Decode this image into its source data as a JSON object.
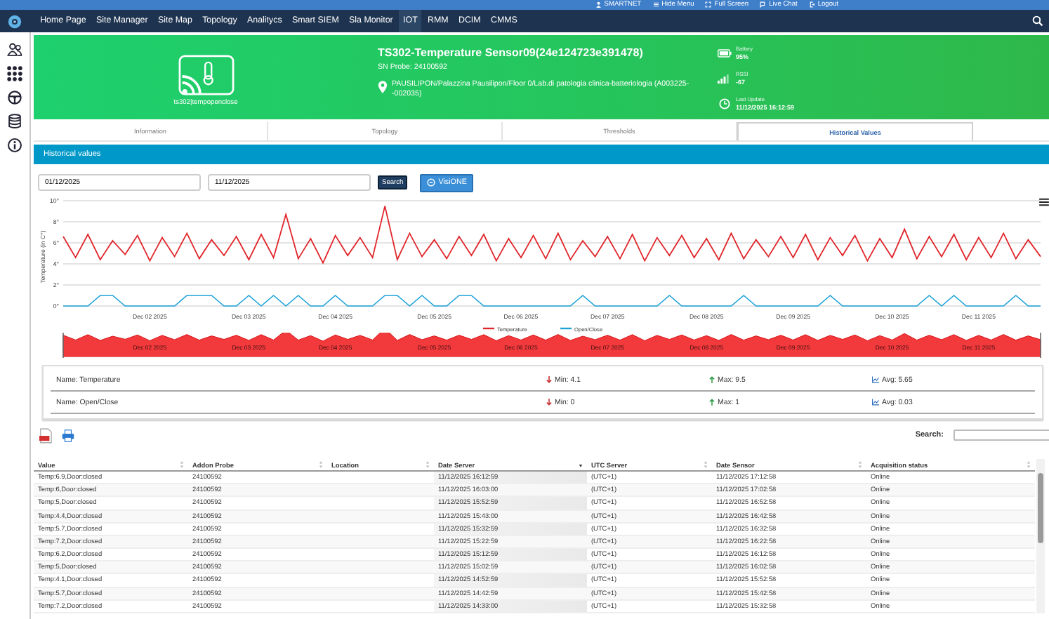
{
  "top_bar": {
    "links": [
      {
        "label": "SMARTNET"
      },
      {
        "label": "Hide Menu"
      },
      {
        "label": "Full Screen"
      },
      {
        "label": "Live Chat"
      },
      {
        "label": "Logout"
      }
    ]
  },
  "nav": {
    "items": [
      {
        "label": "Home Page",
        "selected": false
      },
      {
        "label": "Site Manager",
        "selected": false
      },
      {
        "label": "Site Map",
        "selected": false
      },
      {
        "label": "Topology",
        "selected": false
      },
      {
        "label": "Analitycs",
        "selected": false
      },
      {
        "label": "Smart SIEM",
        "selected": false
      },
      {
        "label": "Sla Monitor",
        "selected": false
      },
      {
        "label": "IOT",
        "selected": true
      },
      {
        "label": "RMM",
        "selected": false
      },
      {
        "label": "DCIM",
        "selected": false
      },
      {
        "label": "CMMS",
        "selected": false
      }
    ]
  },
  "device": {
    "caption": "ts302|tempopenclose",
    "title": "TS302-Temperature Sensor09(24e124723e391478)",
    "sn": "SN Probe: 24100592",
    "location": "PAUSILIPON/Palazzina Pausilipon/Floor 0/Lab.di patologia clinica-batteriologia (A003225--002035)",
    "battery_label": "Battery",
    "battery": "95%",
    "rssi_label": "RSSI",
    "rssi": "-67",
    "update_label": "Last Update",
    "update": "11/12/2025 16:12:59"
  },
  "tabs": [
    {
      "label": "Information",
      "selected": false
    },
    {
      "label": "Topology",
      "selected": false
    },
    {
      "label": "Thresholds",
      "selected": false
    },
    {
      "label": "Historical Values",
      "selected": true
    }
  ],
  "section_title": "Historical values",
  "filters": {
    "from": "01/12/2025",
    "to": "11/12/2025",
    "search_button": "Search",
    "visione_button": "VisiONE"
  },
  "chart_data": {
    "type": "line",
    "ylabel": "Temperature (in C°)",
    "grid": true,
    "legend": "bottom",
    "ylim": [
      0,
      10
    ],
    "categories": [
      null,
      null,
      null,
      null,
      null,
      null,
      null,
      "Dec 02 2025",
      null,
      null,
      null,
      null,
      null,
      null,
      null,
      "Dec 03 2025",
      null,
      null,
      null,
      null,
      null,
      null,
      "Dec 04 2025",
      null,
      null,
      null,
      null,
      null,
      null,
      null,
      "Dec 05 2025",
      null,
      null,
      null,
      null,
      null,
      null,
      "Dec 06 2025",
      null,
      null,
      null,
      null,
      null,
      null,
      "Dec 07 2025",
      null,
      null,
      null,
      null,
      null,
      null,
      null,
      "Dec 08 2025",
      null,
      null,
      null,
      null,
      null,
      null,
      "Dec 09 2025",
      null,
      null,
      null,
      null,
      null,
      null,
      null,
      "Dec 10 2025",
      null,
      null,
      null,
      null,
      null,
      null,
      "Dec 11 2025",
      null,
      null,
      null,
      null,
      null
    ],
    "yticks": [
      {
        "value": 0,
        "label": "0°"
      },
      {
        "value": 2,
        "label": "2°"
      },
      {
        "value": 4,
        "label": "4°"
      },
      {
        "value": 6,
        "label": "6°"
      },
      {
        "value": 8,
        "label": "8°"
      },
      {
        "value": 10,
        "label": "10°"
      }
    ],
    "series": [
      {
        "name": "Temperature",
        "color": "#e0262b",
        "values": [
          6.6,
          4.6,
          6.8,
          4.4,
          6.2,
          4.9,
          6.7,
          4.3,
          6.5,
          4.7,
          6.9,
          4.5,
          6.3,
          4.8,
          6.6,
          4.4,
          6.8,
          4.6,
          8.7,
          4.5,
          6.4,
          4.1,
          6.7,
          4.8,
          6.5,
          4.6,
          9.5,
          4.4,
          6.9,
          4.7,
          6.3,
          4.5,
          6.6,
          4.8,
          6.8,
          4.3,
          6.4,
          4.6,
          6.7,
          4.5,
          6.9,
          4.4,
          6.2,
          4.7,
          6.6,
          4.5,
          6.8,
          4.3,
          6.5,
          4.8,
          6.7,
          4.6,
          6.4,
          4.4,
          6.9,
          4.5,
          6.3,
          4.7,
          6.6,
          4.6,
          6.8,
          4.4,
          6.5,
          4.8,
          6.7,
          4.3,
          6.4,
          4.6,
          7.3,
          4.5,
          6.6,
          4.7,
          6.8,
          4.4,
          6.5,
          4.6,
          6.9,
          4.5,
          6.3,
          4.7
        ]
      },
      {
        "name": "Open/Close",
        "color": "#1ba1d9",
        "values": [
          0,
          0,
          0,
          1,
          1,
          0,
          0,
          0,
          0,
          0,
          1,
          1,
          1,
          0,
          0,
          1,
          0,
          1,
          0,
          1,
          0,
          0,
          1,
          0,
          0,
          0,
          1,
          1,
          0,
          1,
          0,
          0,
          1,
          1,
          0,
          0,
          0,
          0,
          0,
          0,
          0,
          0,
          1,
          0,
          0,
          0,
          0,
          0,
          0,
          1,
          0,
          0,
          0,
          0,
          0,
          1,
          0,
          0,
          0,
          0,
          0,
          0,
          1,
          0,
          0,
          0,
          0,
          0,
          0,
          0,
          1,
          0,
          1,
          0,
          0,
          0,
          0,
          1,
          0,
          0
        ]
      }
    ]
  },
  "navigator": {
    "labels": [
      "Dec 02 2025",
      "Dec 03 2025",
      "Dec 04 2025",
      "Dec 05 2025",
      "Dec 06 2025",
      "Dec 07 2025",
      "Dec 08 2025",
      "Dec 09 2025",
      "Dec 10 2025",
      "Dec 11 2025"
    ]
  },
  "stats": [
    {
      "name": "Name: Temperature",
      "min": "Min: 4.1",
      "max": "Max: 9.5",
      "avg": "Avg: 5.65"
    },
    {
      "name": "Name: Open/Close",
      "min": "Min: 0",
      "max": "Max: 1",
      "avg": "Avg: 0.03"
    }
  ],
  "table": {
    "search_label": "Search:",
    "columns": [
      {
        "label": "Value",
        "sorted": false
      },
      {
        "label": "Addon Probe",
        "sorted": false
      },
      {
        "label": "Location",
        "sorted": false
      },
      {
        "label": "Date Server",
        "sorted": true
      },
      {
        "label": "UTC Server",
        "sorted": false
      },
      {
        "label": "Date Sensor",
        "sorted": false
      },
      {
        "label": "Acquisition status",
        "sorted": false
      }
    ],
    "rows": [
      [
        "Temp:6.9,Door:closed",
        "24100592",
        "",
        "11/12/2025 16:12:59",
        "(UTC+1)",
        "11/12/2025 17:12:58",
        "Online"
      ],
      [
        "Temp:6,Door:closed",
        "24100592",
        "",
        "11/12/2025 16:03:00",
        "(UTC+1)",
        "11/12/2025 17:02:58",
        "Online"
      ],
      [
        "Temp:5,Door:closed",
        "24100592",
        "",
        "11/12/2025 15:52:59",
        "(UTC+1)",
        "11/12/2025 16:52:58",
        "Online"
      ],
      [
        "Temp:4.4,Door:closed",
        "24100592",
        "",
        "11/12/2025 15:43:00",
        "(UTC+1)",
        "11/12/2025 16:42:58",
        "Online"
      ],
      [
        "Temp:5.7,Door:closed",
        "24100592",
        "",
        "11/12/2025 15:32:59",
        "(UTC+1)",
        "11/12/2025 16:32:58",
        "Online"
      ],
      [
        "Temp:7.2,Door:closed",
        "24100592",
        "",
        "11/12/2025 15:22:59",
        "(UTC+1)",
        "11/12/2025 16:22:58",
        "Online"
      ],
      [
        "Temp:6.2,Door:closed",
        "24100592",
        "",
        "11/12/2025 15:12:59",
        "(UTC+1)",
        "11/12/2025 16:12:58",
        "Online"
      ],
      [
        "Temp:5,Door:closed",
        "24100592",
        "",
        "11/12/2025 15:02:59",
        "(UTC+1)",
        "11/12/2025 16:02:58",
        "Online"
      ],
      [
        "Temp:4.1,Door:closed",
        "24100592",
        "",
        "11/12/2025 14:52:59",
        "(UTC+1)",
        "11/12/2025 15:52:58",
        "Online"
      ],
      [
        "Temp:5.7,Door:closed",
        "24100592",
        "",
        "11/12/2025 14:42:59",
        "(UTC+1)",
        "11/12/2025 15:42:58",
        "Online"
      ],
      [
        "Temp:7.2,Door:closed",
        "24100592",
        "",
        "11/12/2025 14:33:00",
        "(UTC+1)",
        "11/12/2025 15:32:58",
        "Online"
      ]
    ]
  }
}
